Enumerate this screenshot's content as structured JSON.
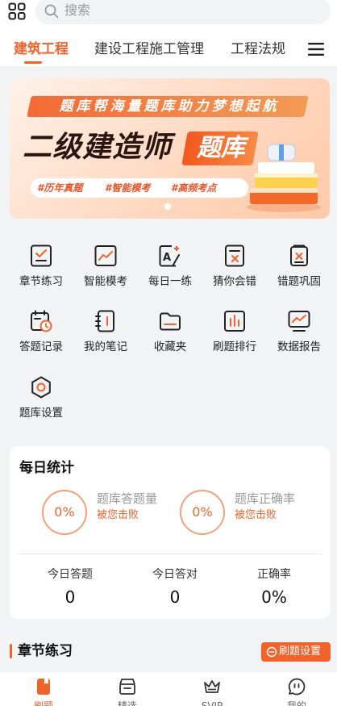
{
  "colors": {
    "accent": "#f0642b",
    "ring": "#f4a07a",
    "page_bg": "#f2f3f5"
  },
  "header": {
    "search_placeholder": "搜索",
    "grid_icon": "apps-grid-icon",
    "menu_icon": "hamburger-menu-icon"
  },
  "tabs": [
    {
      "label": "建筑工程",
      "active": true
    },
    {
      "label": "建设工程施工管理",
      "active": false
    },
    {
      "label": "工程法规",
      "active": false
    }
  ],
  "banner": {
    "ribbon": "题库帮海量题库助力梦想起航",
    "title": "二级建造师",
    "badge": "题库",
    "tags": [
      "#历年真题",
      "#智能模考",
      "#高频考点"
    ]
  },
  "features": [
    {
      "label": "章节练习",
      "icon": "checklist-icon"
    },
    {
      "label": "智能模考",
      "icon": "trend-chart-icon"
    },
    {
      "label": "每日一练",
      "icon": "a-plus-edit-icon"
    },
    {
      "label": "猜你会错",
      "icon": "doc-x-icon"
    },
    {
      "label": "错题巩固",
      "icon": "wrong-doc-icon"
    },
    {
      "label": "答题记录",
      "icon": "calendar-clock-icon"
    },
    {
      "label": "我的笔记",
      "icon": "notebook-icon"
    },
    {
      "label": "收藏夹",
      "icon": "folder-icon"
    },
    {
      "label": "刷题排行",
      "icon": "ranking-bars-icon"
    },
    {
      "label": "数据报告",
      "icon": "monitor-chart-icon"
    },
    {
      "label": "题库设置",
      "icon": "settings-gear-icon"
    }
  ],
  "daily_stats": {
    "title": "每日统计",
    "rings": [
      {
        "value": "0%",
        "label": "题库答题量",
        "sub": "被您击败"
      },
      {
        "value": "0%",
        "label": "题库正确率",
        "sub": "被您击败"
      }
    ],
    "columns": [
      {
        "label": "今日答题",
        "value": "0"
      },
      {
        "label": "今日答对",
        "value": "0"
      },
      {
        "label": "正确率",
        "value": "0%"
      }
    ]
  },
  "section": {
    "title": "章节练习",
    "button": "刷题设置"
  },
  "tabbar": [
    {
      "label": "刷题",
      "icon": "book-icon",
      "active": true
    },
    {
      "label": "精选",
      "icon": "shop-icon",
      "active": false
    },
    {
      "label": "SVIP",
      "icon": "crown-icon",
      "active": false
    },
    {
      "label": "我的",
      "icon": "chat-bubble-icon",
      "active": false
    }
  ]
}
